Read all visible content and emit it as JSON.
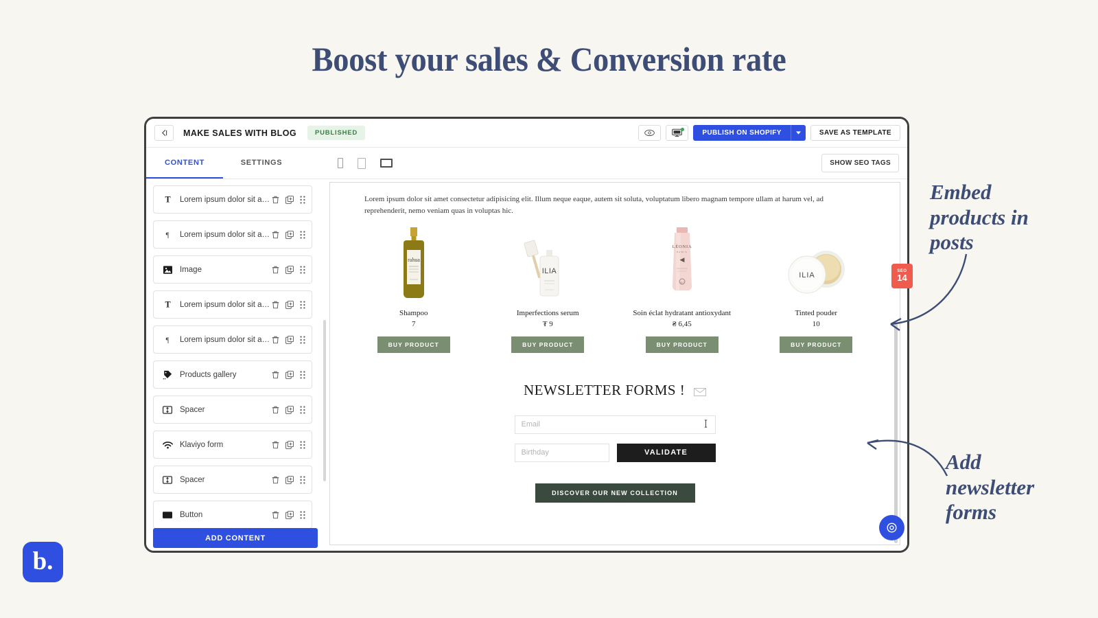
{
  "headline": "Boost your sales & Conversion rate",
  "topbar": {
    "back_icon": "back-arrow-icon",
    "doc_title": "MAKE SALES WITH BLOG",
    "status": "PUBLISHED",
    "preview_icon": "eye-icon",
    "sync_icon": "monitor-sync-icon",
    "publish_label": "PUBLISH ON SHOPIFY",
    "publish_caret": "▼",
    "save_template_label": "SAVE AS TEMPLATE"
  },
  "tabbar": {
    "tabs": [
      {
        "label": "CONTENT",
        "active": true
      },
      {
        "label": "SETTINGS",
        "active": false
      }
    ],
    "devices": [
      "mobile-preview-icon",
      "tablet-preview-icon",
      "desktop-preview-icon"
    ],
    "seo_tags_label": "SHOW SEO TAGS"
  },
  "sidebar": {
    "blocks": [
      {
        "icon": "title-text-icon",
        "label": "Lorem ipsum dolor sit ame..."
      },
      {
        "icon": "paragraph-icon",
        "label": "Lorem ipsum dolor sit ame..."
      },
      {
        "icon": "image-icon",
        "label": "Image"
      },
      {
        "icon": "title-text-icon",
        "label": "Lorem ipsum dolor sit ame..."
      },
      {
        "icon": "paragraph-icon",
        "label": "Lorem ipsum dolor sit ame..."
      },
      {
        "icon": "products-tag-icon",
        "label": "Products gallery"
      },
      {
        "icon": "spacer-icon",
        "label": "Spacer"
      },
      {
        "icon": "klaviyo-wifi-icon",
        "label": "Klaviyo form"
      },
      {
        "icon": "spacer-icon",
        "label": "Spacer"
      },
      {
        "icon": "button-icon",
        "label": "Button"
      }
    ],
    "row_actions": [
      "delete-icon",
      "duplicate-icon",
      "drag-handle-icon"
    ],
    "add_content_label": "ADD CONTENT"
  },
  "canvas": {
    "lede": "Lorem ipsum dolor sit amet consectetur adipisicing elit. Illum neque eaque, autem sit soluta, voluptatum libero magnam tempore ullam at harum vel, ad reprehenderit, nemo veniam quas in voluptas hic.",
    "products": [
      {
        "name": "Shampoo",
        "price": "7",
        "buy_label": "BUY PRODUCT",
        "image": "rahua-shampoo-bottle"
      },
      {
        "name": "Imperfections serum",
        "price": "₮ 9",
        "buy_label": "BUY PRODUCT",
        "image": "ilia-serum-dropper"
      },
      {
        "name": "Soin éclat hydratant antioxydant",
        "price": "₴ 6,45",
        "buy_label": "BUY PRODUCT",
        "image": "leonia-pink-tube"
      },
      {
        "name": "Tinted pouder",
        "price": "10",
        "buy_label": "BUY PRODUCT",
        "image": "ilia-tinted-powder-jar"
      }
    ],
    "newsletter": {
      "title": "NEWSLETTER FORMS !",
      "title_icon": "envelope-icon",
      "email_placeholder": "Email",
      "email_value": "",
      "email_trailing_icon": "text-cursor-icon",
      "birthday_placeholder": "Birthday",
      "birthday_value": "",
      "validate_label": "VALIDATE"
    },
    "discover_label": "DISCOVER OUR NEW COLLECTION"
  },
  "seo_badge": {
    "label": "SEO",
    "score": "14",
    "color": "#ef5b4c"
  },
  "annotations": [
    {
      "text": "Embed products in posts"
    },
    {
      "text": "Add newsletter forms"
    }
  ],
  "logo": {
    "text": "b.",
    "color": "#2f4fe0"
  },
  "help_bubble": {
    "icon": "help-beacon-icon",
    "color": "#2f4fe0"
  },
  "colors": {
    "accent_blue": "#2f4fe0",
    "navy_text": "#3e4d75",
    "page_bg": "#f7f6f1",
    "buy_green": "#7a8f72",
    "discover_green": "#3b4a3e",
    "published_green": "#3b7d45"
  }
}
